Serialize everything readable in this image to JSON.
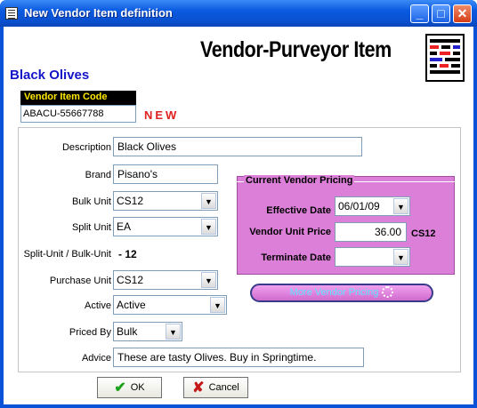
{
  "window": {
    "title": "New Vendor Item definition",
    "minimize": "_",
    "maximize": "□",
    "close": "✕"
  },
  "header": {
    "title": "Vendor-Purveyor Item",
    "item_name": "Black Olives"
  },
  "vendor_item_code": {
    "label": "Vendor Item Code",
    "value": "ABACU-55667788",
    "new_tag": "NEW"
  },
  "fields": {
    "description": {
      "label": "Description",
      "value": "Black Olives"
    },
    "brand": {
      "label": "Brand",
      "value": "Pisano's"
    },
    "bulk_unit": {
      "label": "Bulk Unit",
      "value": "CS12"
    },
    "split_unit": {
      "label": "Split Unit",
      "value": "EA"
    },
    "ratio": {
      "label": "Split-Unit / Bulk-Unit",
      "value": "12"
    },
    "purchase_unit": {
      "label": "Purchase Unit",
      "value": "CS12"
    },
    "active": {
      "label": "Active",
      "value": "Active"
    },
    "priced_by": {
      "label": "Priced By",
      "value": "Bulk"
    },
    "advice": {
      "label": "Advice",
      "value": "These are tasty Olives.  Buy in Springtime."
    }
  },
  "pricing": {
    "title": "Current Vendor Pricing",
    "effective_date": {
      "label": "Effective Date",
      "value": "06/01/09"
    },
    "unit_price": {
      "label": "Vendor Unit Price",
      "value": "36.00",
      "unit": "CS12"
    },
    "terminate_date": {
      "label": "Terminate Date",
      "value": ""
    },
    "more_button": "More Vendor Pricing"
  },
  "buttons": {
    "ok": "OK",
    "cancel": "Cancel"
  },
  "colors": {
    "title_bar": "#0a5ae0",
    "item_name": "#1414c8",
    "code_label_bg": "#000000",
    "code_label_text": "#ffe900",
    "new_tag": "#e02020",
    "pricing_bg": "#db7fd9",
    "more_button_text": "#5ce7ff"
  },
  "icons": {
    "window": "form-icon",
    "logo": "vendor-grid-logo",
    "dropdown": "chevron-down-icon",
    "more": "gear-icon",
    "ok": "check-icon",
    "cancel": "x-icon"
  }
}
